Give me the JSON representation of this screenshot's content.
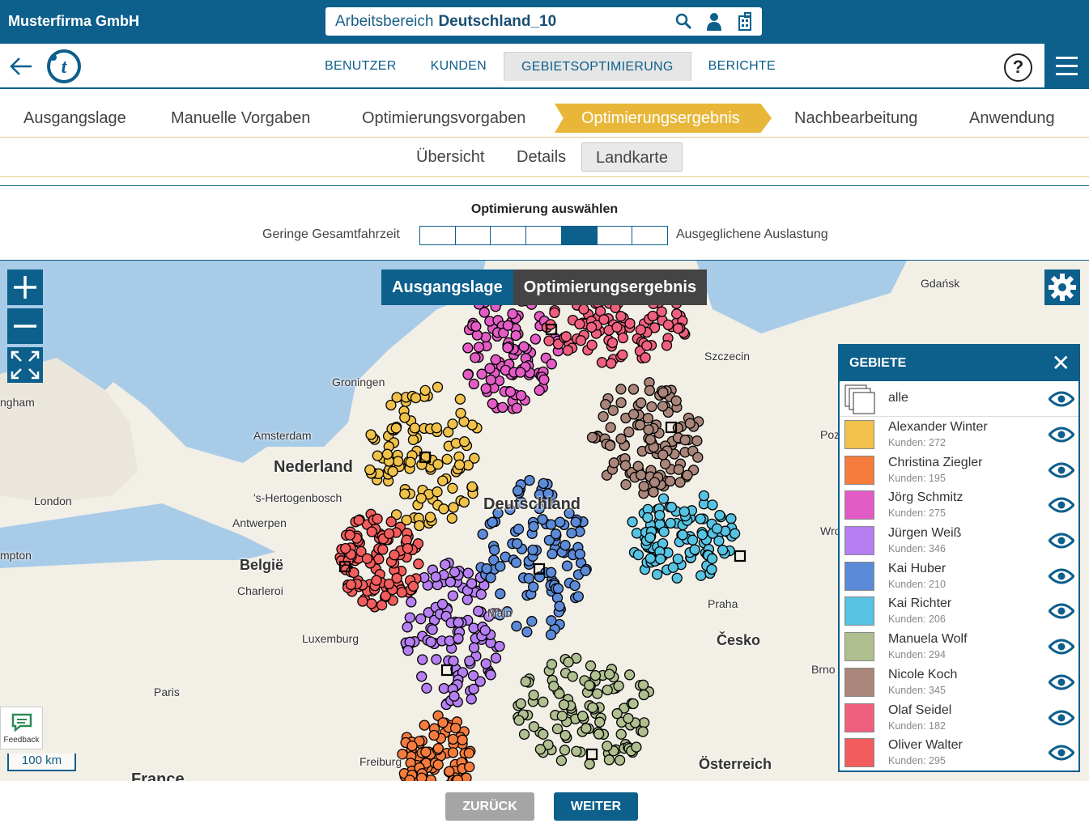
{
  "header": {
    "company": "Musterfirma GmbH",
    "workspace_prefix": "Arbeitsbereich",
    "workspace_name": "Deutschland_10",
    "icons": [
      "search-user-icon",
      "person-icon",
      "building-icon"
    ]
  },
  "nav": {
    "tabs": [
      {
        "label": "BENUTZER",
        "active": false
      },
      {
        "label": "KUNDEN",
        "active": false
      },
      {
        "label": "GEBIETSOPTIMIERUNG",
        "active": true
      },
      {
        "label": "BERICHTE",
        "active": false
      }
    ],
    "help": "?"
  },
  "steps": [
    "Ausgangslage",
    "Manuelle Vorgaben",
    "Optimierungsvorgaben",
    "Optimierungsergebnis",
    "Nachbearbeitung",
    "Anwendung"
  ],
  "active_step": "Optimierungsergebnis",
  "subtabs": [
    "Übersicht",
    "Details",
    "Landkarte"
  ],
  "active_subtab": "Landkarte",
  "optimization": {
    "title": "Optimierung auswählen",
    "left_label": "Geringe Gesamtfahrzeit",
    "right_label": "Ausgeglichene Auslastung",
    "segments": 7,
    "selected_segment": 5
  },
  "map": {
    "view_tabs": [
      "Ausgangslage",
      "Optimierungsergebnis"
    ],
    "active_view": "Optimierungsergebnis",
    "scale": "100 km",
    "feedback": "Feedback",
    "labels": [
      "Gdańsk",
      "Szczecin",
      "Groningen",
      "ngham",
      "Amsterdam",
      "Nederland",
      "London",
      "'s-Hertogenbosch",
      "Antwerpen",
      "mpton",
      "België",
      "Charleroi",
      "Luxemburg",
      "Paris",
      "Freiburg",
      "France",
      "Deutschland",
      "Praha",
      "Česko",
      "Brno",
      "Österreich",
      "Wro",
      "Poz",
      "Main"
    ]
  },
  "panel": {
    "title": "GEBIETE",
    "all_label": "alle",
    "territories": [
      {
        "name": "Alexander Winter",
        "count": "Kunden: 272",
        "color": "#f0c24b"
      },
      {
        "name": "Christina Ziegler",
        "count": "Kunden: 195",
        "color": "#f57c3d"
      },
      {
        "name": "Jörg Schmitz",
        "count": "Kunden: 275",
        "color": "#e35bc4"
      },
      {
        "name": "Jürgen Weiß",
        "count": "Kunden: 346",
        "color": "#b57ff2"
      },
      {
        "name": "Kai Huber",
        "count": "Kunden: 210",
        "color": "#5b8ad8"
      },
      {
        "name": "Kai Richter",
        "count": "Kunden: 206",
        "color": "#57c3e3"
      },
      {
        "name": "Manuela Wolf",
        "count": "Kunden: 294",
        "color": "#afbf8f"
      },
      {
        "name": "Nicole Koch",
        "count": "Kunden: 345",
        "color": "#a9857a"
      },
      {
        "name": "Olaf Seidel",
        "count": "Kunden: 182",
        "color": "#f0607e"
      },
      {
        "name": "Oliver Walter",
        "count": "Kunden: 295",
        "color": "#f25c5c"
      }
    ]
  },
  "footer": {
    "back": "ZURÜCK",
    "next": "WEITER"
  }
}
